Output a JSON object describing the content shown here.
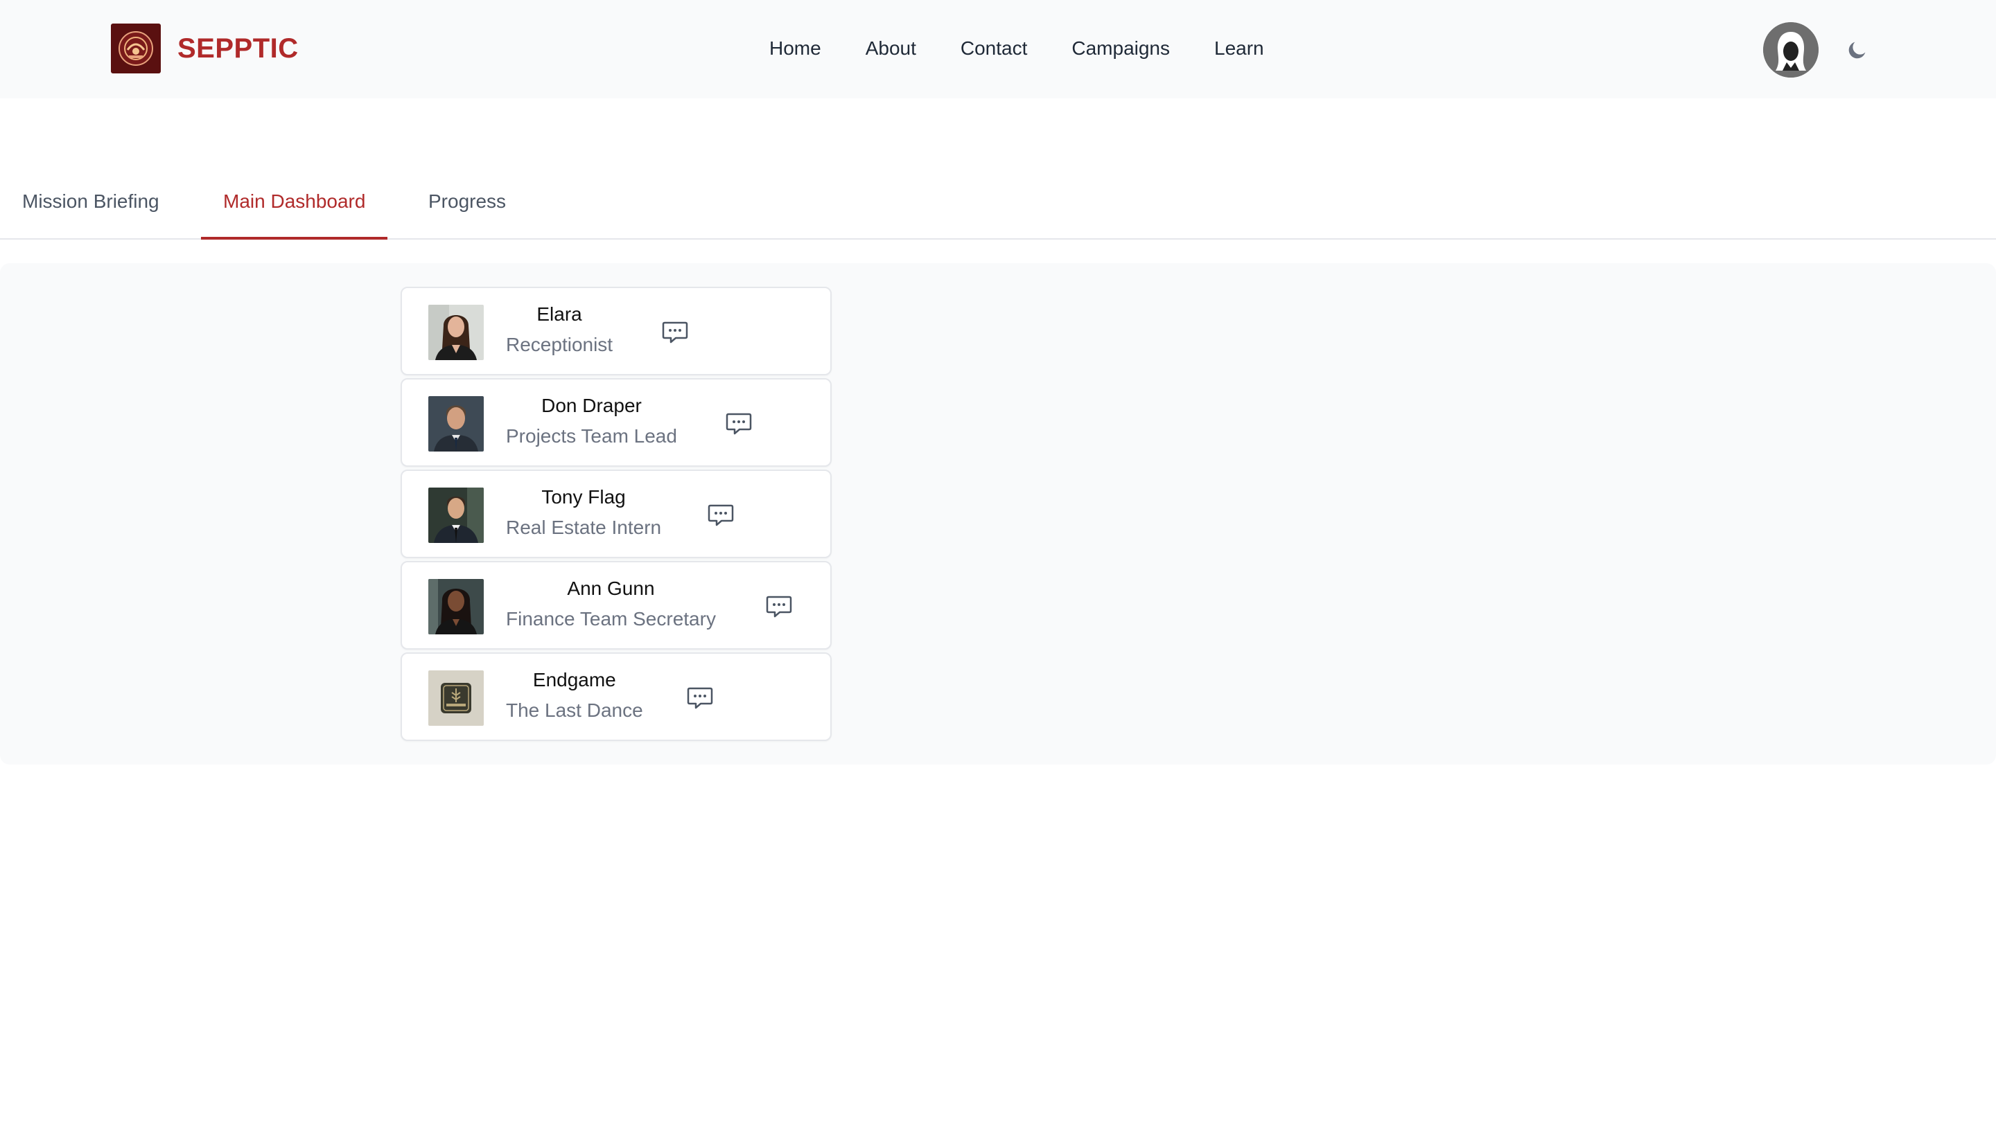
{
  "header": {
    "brand": "SEPPTIC",
    "logo_icon": "sepptic-logo-icon",
    "nav": [
      "Home",
      "About",
      "Contact",
      "Campaigns",
      "Learn"
    ],
    "avatar_icon": "hooded-user-avatar-icon",
    "theme_toggle_icon": "moon-icon"
  },
  "tabs": [
    {
      "label": "Mission Briefing",
      "active": false
    },
    {
      "label": "Main Dashboard",
      "active": true
    },
    {
      "label": "Progress",
      "active": false
    }
  ],
  "contacts": [
    {
      "name": "Elara",
      "role": "Receptionist",
      "chat_icon": "chat-bubble-icon"
    },
    {
      "name": "Don Draper",
      "role": "Projects Team Lead",
      "chat_icon": "chat-bubble-icon"
    },
    {
      "name": "Tony Flag",
      "role": "Real Estate Intern",
      "chat_icon": "chat-bubble-icon"
    },
    {
      "name": "Ann Gunn",
      "role": "Finance Team Secretary",
      "chat_icon": "chat-bubble-icon"
    },
    {
      "name": "Endgame",
      "role": "The Last Dance",
      "chat_icon": "chat-bubble-icon"
    }
  ],
  "colors": {
    "accent": "#b02a2a",
    "logo_bg": "#5a1010",
    "panel_bg": "#f9fafb",
    "muted_text": "#6b7280"
  }
}
